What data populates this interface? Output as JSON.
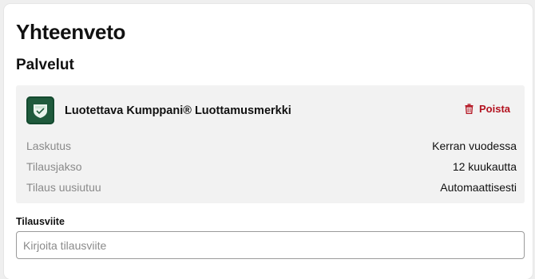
{
  "page": {
    "title": "Yhteenveto"
  },
  "services": {
    "heading": "Palvelut",
    "item": {
      "name": "Luotettava Kumppani® Luottamusmerkki",
      "logo_icon": "shield-badge-icon",
      "remove_label": "Poista",
      "remove_icon": "trash-icon",
      "details": [
        {
          "label": "Laskutus",
          "value": "Kerran vuodessa"
        },
        {
          "label": "Tilausjakso",
          "value": "12 kuukautta"
        },
        {
          "label": "Tilaus uusiutuu",
          "value": "Automaattisesti"
        }
      ]
    }
  },
  "order_reference": {
    "label": "Tilausviite",
    "value": "",
    "placeholder": "Kirjoita tilausviite"
  },
  "colors": {
    "accent_danger": "#b3121f",
    "logo_green": "#1f5a3c",
    "service_background": "#f2f2f2"
  }
}
